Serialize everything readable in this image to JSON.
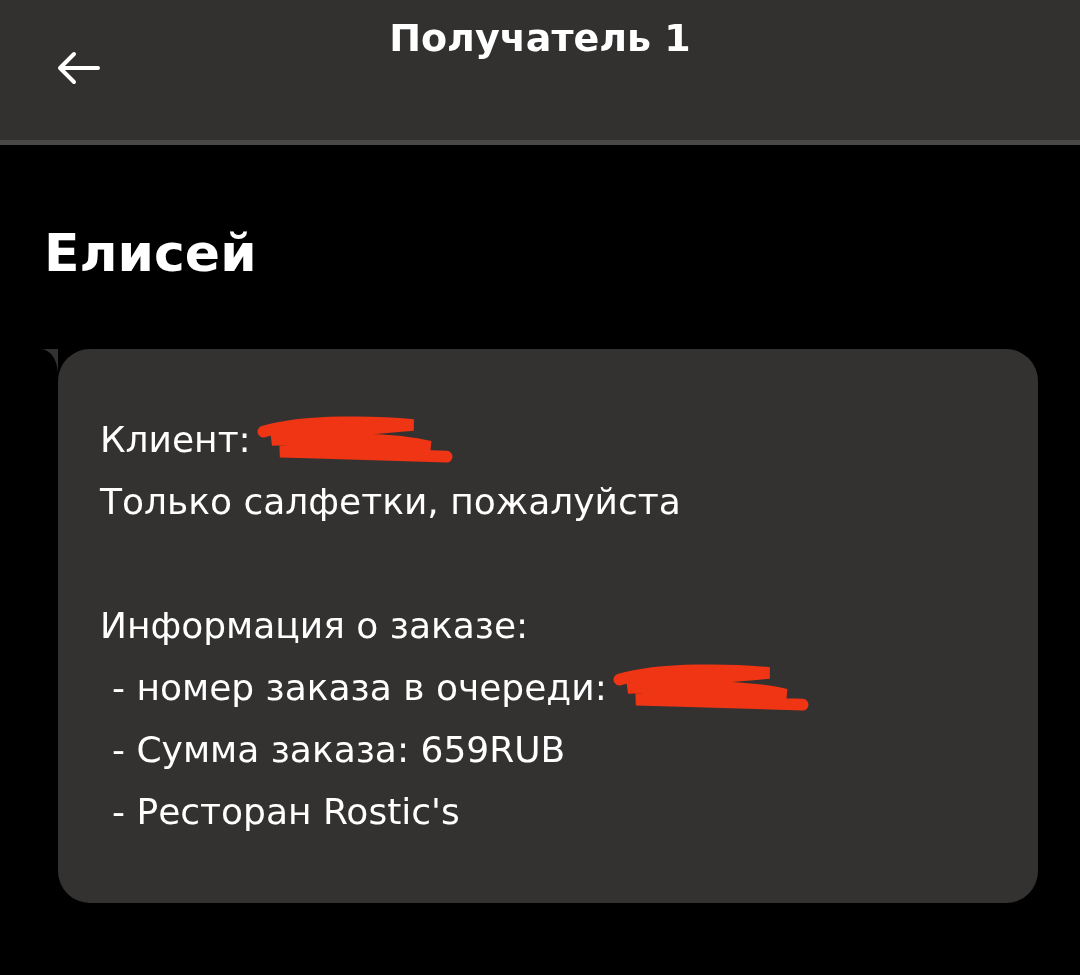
{
  "header": {
    "title": "Получатель 1"
  },
  "sender": {
    "name": "Елисей"
  },
  "message": {
    "lines": [
      {
        "kind": "plain",
        "text": "Клиент:",
        "redacted": true,
        "gap_before": false
      },
      {
        "kind": "plain",
        "text": "Только салфетки, пожалуйста",
        "redacted": false,
        "gap_before": false
      },
      {
        "kind": "plain",
        "text": "Информация о заказе:",
        "redacted": false,
        "gap_before": true
      },
      {
        "kind": "bullet",
        "text": "- номер заказа в очереди:",
        "redacted": true,
        "gap_before": false
      },
      {
        "kind": "bullet",
        "text": "- Сумма заказа: 659RUB",
        "redacted": false,
        "gap_before": false
      },
      {
        "kind": "bullet",
        "text": "- Ресторан Rostic's",
        "redacted": false,
        "gap_before": false
      }
    ]
  }
}
